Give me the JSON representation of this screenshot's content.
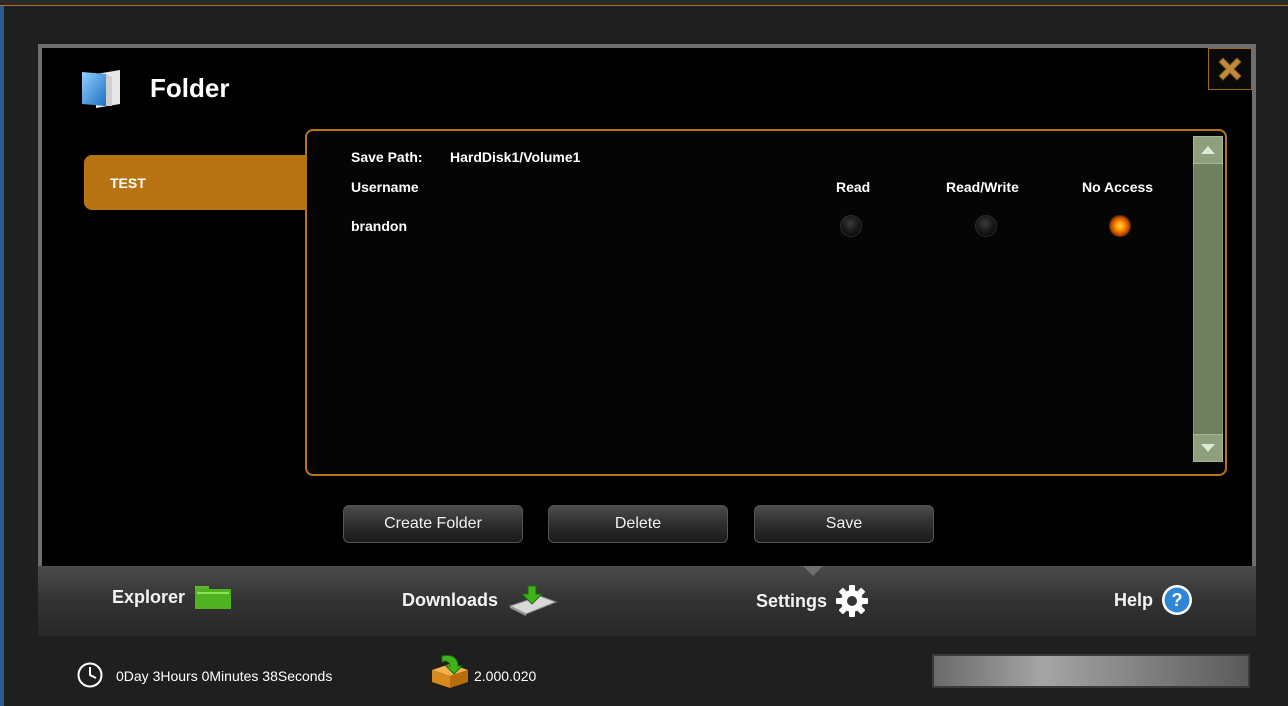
{
  "window": {
    "title": "Folder"
  },
  "folders": [
    {
      "name": "TEST",
      "selected": true
    }
  ],
  "details": {
    "save_path_label": "Save Path:",
    "save_path_value": "HardDisk1/Volume1",
    "columns": {
      "username": "Username",
      "read": "Read",
      "read_write": "Read/Write",
      "no_access": "No Access"
    },
    "users": [
      {
        "name": "brandon",
        "permission": "No Access"
      }
    ]
  },
  "actions": {
    "create_folder": "Create Folder",
    "delete": "Delete",
    "save": "Save"
  },
  "nav": [
    {
      "label": "Explorer",
      "icon": "folder-icon"
    },
    {
      "label": "Downloads",
      "icon": "download-icon"
    },
    {
      "label": "Settings",
      "icon": "gear-icon",
      "active": true
    },
    {
      "label": "Help",
      "icon": "help-icon"
    }
  ],
  "status": {
    "uptime": "0Day 3Hours 0Minutes 38Seconds",
    "download_count": "2.000.020"
  },
  "colors": {
    "accent": "#b87412",
    "panel_border": "#6e6e6e",
    "scrollbar": "#8d9f7c",
    "help_blue": "#2f86d6"
  }
}
